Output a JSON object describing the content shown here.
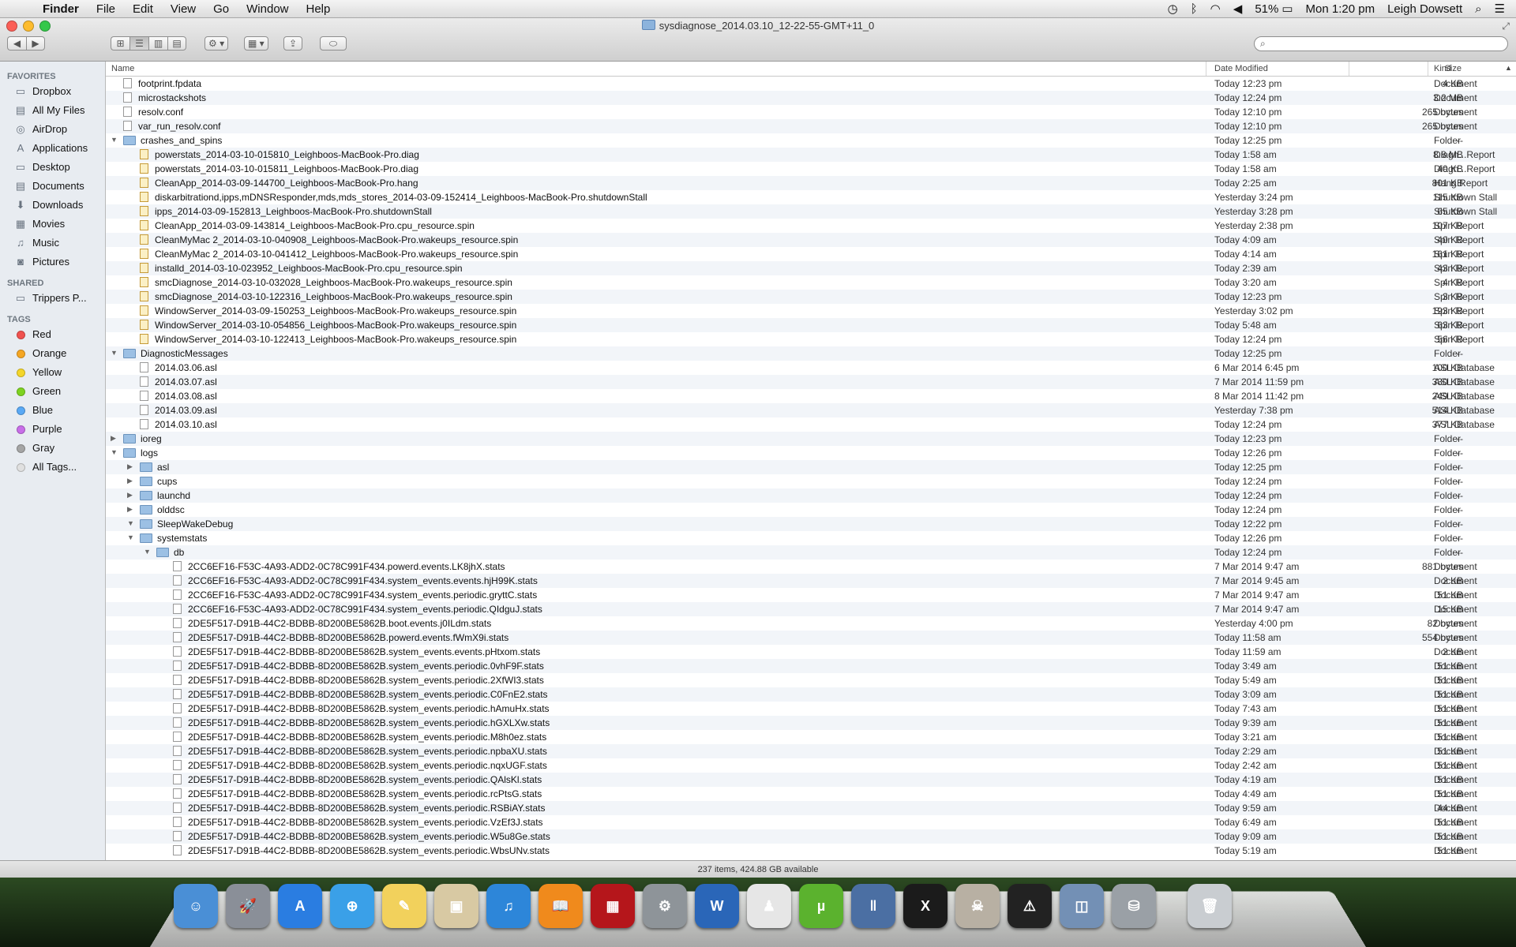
{
  "menubar": {
    "app": "Finder",
    "items": [
      "File",
      "Edit",
      "View",
      "Go",
      "Window",
      "Help"
    ],
    "battery": "51%",
    "clock": "Mon 1:20 pm",
    "user": "Leigh Dowsett"
  },
  "window": {
    "title": "sysdiagnose_2014.03.10_12-22-55-GMT+11_0",
    "search_value": ""
  },
  "sidebar": {
    "favorites_label": "FAVORITES",
    "favorites": [
      {
        "label": "Dropbox",
        "icon": "folder-icon"
      },
      {
        "label": "All My Files",
        "icon": "all-files-icon"
      },
      {
        "label": "AirDrop",
        "icon": "airdrop-icon"
      },
      {
        "label": "Applications",
        "icon": "applications-icon"
      },
      {
        "label": "Desktop",
        "icon": "desktop-icon"
      },
      {
        "label": "Documents",
        "icon": "documents-icon"
      },
      {
        "label": "Downloads",
        "icon": "downloads-icon"
      },
      {
        "label": "Movies",
        "icon": "movies-icon"
      },
      {
        "label": "Music",
        "icon": "music-icon"
      },
      {
        "label": "Pictures",
        "icon": "camera-icon"
      }
    ],
    "shared_label": "SHARED",
    "shared": [
      {
        "label": "Trippers P...",
        "icon": "computer-icon"
      }
    ],
    "tags_label": "TAGS",
    "tags": [
      {
        "label": "Red",
        "color": "#f0524f"
      },
      {
        "label": "Orange",
        "color": "#f5a623"
      },
      {
        "label": "Yellow",
        "color": "#f4d62a"
      },
      {
        "label": "Green",
        "color": "#7ed321"
      },
      {
        "label": "Blue",
        "color": "#5aa9f5"
      },
      {
        "label": "Purple",
        "color": "#c86ee8"
      },
      {
        "label": "Gray",
        "color": "#a5a5a5"
      },
      {
        "label": "All Tags...",
        "color": "#e0e0e0"
      }
    ]
  },
  "columns": {
    "name": "Name",
    "date": "Date Modified",
    "size": "Size",
    "kind": "Kind"
  },
  "files": [
    {
      "level": 0,
      "type": "doc",
      "name": "footprint.fpdata",
      "date": "Today 12:23 pm",
      "size": "4 KB",
      "kind": "Document"
    },
    {
      "level": 0,
      "type": "doc",
      "name": "microstackshots",
      "date": "Today 12:24 pm",
      "size": "3.2 MB",
      "kind": "Document"
    },
    {
      "level": 0,
      "type": "doc",
      "name": "resolv.conf",
      "date": "Today 12:10 pm",
      "size": "265 bytes",
      "kind": "Document"
    },
    {
      "level": 0,
      "type": "doc",
      "name": "var_run_resolv.conf",
      "date": "Today 12:10 pm",
      "size": "265 bytes",
      "kind": "Document"
    },
    {
      "level": 0,
      "type": "folder",
      "tri": "open",
      "name": "crashes_and_spins",
      "date": "Today 12:25 pm",
      "size": "--",
      "kind": "Folder"
    },
    {
      "level": 1,
      "type": "report",
      "name": "powerstats_2014-03-10-015810_Leighboos-MacBook-Pro.diag",
      "date": "Today 1:58 am",
      "size": "8.8 MB",
      "kind": "Diagn...Report"
    },
    {
      "level": 1,
      "type": "report",
      "name": "powerstats_2014-03-10-015811_Leighboos-MacBook-Pro.diag",
      "date": "Today 1:58 am",
      "size": "40 KB",
      "kind": "Diagn...Report"
    },
    {
      "level": 1,
      "type": "report",
      "name": "CleanApp_2014-03-09-144700_Leighboos-MacBook-Pro.hang",
      "date": "Today 2:25 am",
      "size": "801 KB",
      "kind": "Hang Report"
    },
    {
      "level": 1,
      "type": "report",
      "name": "diskarbitrationd,ipps,mDNSResponder,mds,mds_stores_2014-03-09-152414_Leighboos-MacBook-Pro.shutdownStall",
      "date": "Yesterday 3:24 pm",
      "size": "115 KB",
      "kind": "Shutdown Stall"
    },
    {
      "level": 1,
      "type": "report",
      "name": "ipps_2014-03-09-152813_Leighboos-MacBook-Pro.shutdownStall",
      "date": "Yesterday 3:28 pm",
      "size": "65 KB",
      "kind": "Shutdown Stall"
    },
    {
      "level": 1,
      "type": "report",
      "name": "CleanApp_2014-03-09-143814_Leighboos-MacBook-Pro.cpu_resource.spin",
      "date": "Yesterday 2:38 pm",
      "size": "107 KB",
      "kind": "Spin Report"
    },
    {
      "level": 1,
      "type": "report",
      "name": "CleanMyMac 2_2014-03-10-040908_Leighboos-MacBook-Pro.wakeups_resource.spin",
      "date": "Today 4:09 am",
      "size": "40 KB",
      "kind": "Spin Report"
    },
    {
      "level": 1,
      "type": "report",
      "name": "CleanMyMac 2_2014-03-10-041412_Leighboos-MacBook-Pro.wakeups_resource.spin",
      "date": "Today 4:14 am",
      "size": "161 KB",
      "kind": "Spin Report"
    },
    {
      "level": 1,
      "type": "report",
      "name": "installd_2014-03-10-023952_Leighboos-MacBook-Pro.cpu_resource.spin",
      "date": "Today 2:39 am",
      "size": "43 KB",
      "kind": "Spin Report"
    },
    {
      "level": 1,
      "type": "report",
      "name": "smcDiagnose_2014-03-10-032028_Leighboos-MacBook-Pro.wakeups_resource.spin",
      "date": "Today 3:20 am",
      "size": "4 KB",
      "kind": "Spin Report"
    },
    {
      "level": 1,
      "type": "report",
      "name": "smcDiagnose_2014-03-10-122316_Leighboos-MacBook-Pro.wakeups_resource.spin",
      "date": "Today 12:23 pm",
      "size": "3 KB",
      "kind": "Spin Report"
    },
    {
      "level": 1,
      "type": "report",
      "name": "WindowServer_2014-03-09-150253_Leighboos-MacBook-Pro.wakeups_resource.spin",
      "date": "Yesterday 3:02 pm",
      "size": "193 KB",
      "kind": "Spin Report"
    },
    {
      "level": 1,
      "type": "report",
      "name": "WindowServer_2014-03-10-054856_Leighboos-MacBook-Pro.wakeups_resource.spin",
      "date": "Today 5:48 am",
      "size": "63 KB",
      "kind": "Spin Report"
    },
    {
      "level": 1,
      "type": "report",
      "name": "WindowServer_2014-03-10-122413_Leighboos-MacBook-Pro.wakeups_resource.spin",
      "date": "Today 12:24 pm",
      "size": "56 KB",
      "kind": "Spin Report"
    },
    {
      "level": 0,
      "type": "folder",
      "tri": "open",
      "name": "DiagnosticMessages",
      "date": "Today 12:25 pm",
      "size": "--",
      "kind": "Folder"
    },
    {
      "level": 1,
      "type": "doc",
      "name": "2014.03.06.asl",
      "date": "6 Mar 2014 6:45 pm",
      "size": "100 KB",
      "kind": "ASL Database"
    },
    {
      "level": 1,
      "type": "doc",
      "name": "2014.03.07.asl",
      "date": "7 Mar 2014 11:59 pm",
      "size": "330 KB",
      "kind": "ASL Database"
    },
    {
      "level": 1,
      "type": "doc",
      "name": "2014.03.08.asl",
      "date": "8 Mar 2014 11:42 pm",
      "size": "249 KB",
      "kind": "ASL Database"
    },
    {
      "level": 1,
      "type": "doc",
      "name": "2014.03.09.asl",
      "date": "Yesterday 7:38 pm",
      "size": "514 KB",
      "kind": "ASL Database"
    },
    {
      "level": 1,
      "type": "doc",
      "name": "2014.03.10.asl",
      "date": "Today 12:24 pm",
      "size": "377 KB",
      "kind": "ASL Database"
    },
    {
      "level": 0,
      "type": "folder",
      "tri": "closed",
      "name": "ioreg",
      "date": "Today 12:23 pm",
      "size": "--",
      "kind": "Folder"
    },
    {
      "level": 0,
      "type": "folder",
      "tri": "open",
      "name": "logs",
      "date": "Today 12:26 pm",
      "size": "--",
      "kind": "Folder"
    },
    {
      "level": 1,
      "type": "folder",
      "tri": "closed",
      "name": "asl",
      "date": "Today 12:25 pm",
      "size": "--",
      "kind": "Folder"
    },
    {
      "level": 1,
      "type": "folder",
      "tri": "closed",
      "name": "cups",
      "date": "Today 12:24 pm",
      "size": "--",
      "kind": "Folder"
    },
    {
      "level": 1,
      "type": "folder",
      "tri": "closed",
      "name": "launchd",
      "date": "Today 12:24 pm",
      "size": "--",
      "kind": "Folder"
    },
    {
      "level": 1,
      "type": "folder",
      "tri": "closed",
      "name": "olddsc",
      "date": "Today 12:24 pm",
      "size": "--",
      "kind": "Folder"
    },
    {
      "level": 1,
      "type": "folder",
      "tri": "open",
      "name": "SleepWakeDebug",
      "date": "Today 12:22 pm",
      "size": "--",
      "kind": "Folder"
    },
    {
      "level": 1,
      "type": "folder",
      "tri": "open",
      "name": "systemstats",
      "date": "Today 12:26 pm",
      "size": "--",
      "kind": "Folder"
    },
    {
      "level": 2,
      "type": "folder",
      "tri": "open",
      "name": "db",
      "date": "Today 12:24 pm",
      "size": "--",
      "kind": "Folder"
    },
    {
      "level": 3,
      "type": "doc",
      "name": "2CC6EF16-F53C-4A93-ADD2-0C78C991F434.powerd.events.LK8jhX.stats",
      "date": "7 Mar 2014 9:47 am",
      "size": "881 bytes",
      "kind": "Document"
    },
    {
      "level": 3,
      "type": "doc",
      "name": "2CC6EF16-F53C-4A93-ADD2-0C78C991F434.system_events.events.hjH99K.stats",
      "date": "7 Mar 2014 9:45 am",
      "size": "2 KB",
      "kind": "Document"
    },
    {
      "level": 3,
      "type": "doc",
      "name": "2CC6EF16-F53C-4A93-ADD2-0C78C991F434.system_events.periodic.gryttC.stats",
      "date": "7 Mar 2014 9:47 am",
      "size": "51 KB",
      "kind": "Document"
    },
    {
      "level": 3,
      "type": "doc",
      "name": "2CC6EF16-F53C-4A93-ADD2-0C78C991F434.system_events.periodic.QIdguJ.stats",
      "date": "7 Mar 2014 9:47 am",
      "size": "15 KB",
      "kind": "Document"
    },
    {
      "level": 3,
      "type": "doc",
      "name": "2DE5F517-D91B-44C2-BDBB-8D200BE5862B.boot.events.j0ILdm.stats",
      "date": "Yesterday 4:00 pm",
      "size": "82 bytes",
      "kind": "Document"
    },
    {
      "level": 3,
      "type": "doc",
      "name": "2DE5F517-D91B-44C2-BDBB-8D200BE5862B.powerd.events.fWmX9i.stats",
      "date": "Today 11:58 am",
      "size": "554 bytes",
      "kind": "Document"
    },
    {
      "level": 3,
      "type": "doc",
      "name": "2DE5F517-D91B-44C2-BDBB-8D200BE5862B.system_events.events.pHtxom.stats",
      "date": "Today 11:59 am",
      "size": "2 KB",
      "kind": "Document"
    },
    {
      "level": 3,
      "type": "doc",
      "name": "2DE5F517-D91B-44C2-BDBB-8D200BE5862B.system_events.periodic.0vhF9F.stats",
      "date": "Today 3:49 am",
      "size": "51 KB",
      "kind": "Document"
    },
    {
      "level": 3,
      "type": "doc",
      "name": "2DE5F517-D91B-44C2-BDBB-8D200BE5862B.system_events.periodic.2XfWI3.stats",
      "date": "Today 5:49 am",
      "size": "51 KB",
      "kind": "Document"
    },
    {
      "level": 3,
      "type": "doc",
      "name": "2DE5F517-D91B-44C2-BDBB-8D200BE5862B.system_events.periodic.C0FnE2.stats",
      "date": "Today 3:09 am",
      "size": "51 KB",
      "kind": "Document"
    },
    {
      "level": 3,
      "type": "doc",
      "name": "2DE5F517-D91B-44C2-BDBB-8D200BE5862B.system_events.periodic.hAmuHx.stats",
      "date": "Today 7:43 am",
      "size": "51 KB",
      "kind": "Document"
    },
    {
      "level": 3,
      "type": "doc",
      "name": "2DE5F517-D91B-44C2-BDBB-8D200BE5862B.system_events.periodic.hGXLXw.stats",
      "date": "Today 9:39 am",
      "size": "51 KB",
      "kind": "Document"
    },
    {
      "level": 3,
      "type": "doc",
      "name": "2DE5F517-D91B-44C2-BDBB-8D200BE5862B.system_events.periodic.M8h0ez.stats",
      "date": "Today 3:21 am",
      "size": "51 KB",
      "kind": "Document"
    },
    {
      "level": 3,
      "type": "doc",
      "name": "2DE5F517-D91B-44C2-BDBB-8D200BE5862B.system_events.periodic.npbaXU.stats",
      "date": "Today 2:29 am",
      "size": "51 KB",
      "kind": "Document"
    },
    {
      "level": 3,
      "type": "doc",
      "name": "2DE5F517-D91B-44C2-BDBB-8D200BE5862B.system_events.periodic.nqxUGF.stats",
      "date": "Today 2:42 am",
      "size": "51 KB",
      "kind": "Document"
    },
    {
      "level": 3,
      "type": "doc",
      "name": "2DE5F517-D91B-44C2-BDBB-8D200BE5862B.system_events.periodic.QAlsKl.stats",
      "date": "Today 4:19 am",
      "size": "51 KB",
      "kind": "Document"
    },
    {
      "level": 3,
      "type": "doc",
      "name": "2DE5F517-D91B-44C2-BDBB-8D200BE5862B.system_events.periodic.rcPtsG.stats",
      "date": "Today 4:49 am",
      "size": "51 KB",
      "kind": "Document"
    },
    {
      "level": 3,
      "type": "doc",
      "name": "2DE5F517-D91B-44C2-BDBB-8D200BE5862B.system_events.periodic.RSBiAY.stats",
      "date": "Today 9:59 am",
      "size": "44 KB",
      "kind": "Document"
    },
    {
      "level": 3,
      "type": "doc",
      "name": "2DE5F517-D91B-44C2-BDBB-8D200BE5862B.system_events.periodic.VzEf3J.stats",
      "date": "Today 6:49 am",
      "size": "51 KB",
      "kind": "Document"
    },
    {
      "level": 3,
      "type": "doc",
      "name": "2DE5F517-D91B-44C2-BDBB-8D200BE5862B.system_events.periodic.W5u8Ge.stats",
      "date": "Today 9:09 am",
      "size": "51 KB",
      "kind": "Document"
    },
    {
      "level": 3,
      "type": "doc",
      "name": "2DE5F517-D91B-44C2-BDBB-8D200BE5862B.system_events.periodic.WbsUNv.stats",
      "date": "Today 5:19 am",
      "size": "51 KB",
      "kind": "Document"
    }
  ],
  "status": "237 items, 424.88 GB available",
  "dock": [
    {
      "name": "finder-icon",
      "color": "#4a8fd6",
      "glyph": "☺"
    },
    {
      "name": "launchpad-icon",
      "color": "#8a8f98",
      "glyph": "🚀"
    },
    {
      "name": "app-store-icon",
      "color": "#2a7de1",
      "glyph": "A"
    },
    {
      "name": "safari-icon",
      "color": "#3aa0e8",
      "glyph": "⊕"
    },
    {
      "name": "notes-icon",
      "color": "#f2d15c",
      "glyph": "✎"
    },
    {
      "name": "preview-icon",
      "color": "#d8c9a3",
      "glyph": "▣"
    },
    {
      "name": "itunes-icon",
      "color": "#2d86d9",
      "glyph": "♫"
    },
    {
      "name": "ibooks-icon",
      "color": "#f08a1c",
      "glyph": "📖"
    },
    {
      "name": "photo-booth-icon",
      "color": "#b5161b",
      "glyph": "▦"
    },
    {
      "name": "system-preferences-icon",
      "color": "#8e9499",
      "glyph": "⚙"
    },
    {
      "name": "word-icon",
      "color": "#2a66b8",
      "glyph": "W"
    },
    {
      "name": "puppet-icon",
      "color": "#e6e6e6",
      "glyph": "♟"
    },
    {
      "name": "utorrent-icon",
      "color": "#5bb22e",
      "glyph": "µ"
    },
    {
      "name": "pause-app-icon",
      "color": "#4b6fa3",
      "glyph": "‖"
    },
    {
      "name": "xbmc-icon",
      "color": "#1b1b1b",
      "glyph": "X"
    },
    {
      "name": "skull-app-icon",
      "color": "#b8b0a3",
      "glyph": "☠"
    },
    {
      "name": "console-icon",
      "color": "#222222",
      "glyph": "⚠"
    },
    {
      "name": "photos-icon",
      "color": "#7390b5",
      "glyph": "◫"
    },
    {
      "name": "disk-utility-icon",
      "color": "#9aa0a6",
      "glyph": "⛁"
    },
    {
      "name": "trash-icon",
      "color": "#c9cdd1",
      "glyph": "🗑"
    }
  ]
}
